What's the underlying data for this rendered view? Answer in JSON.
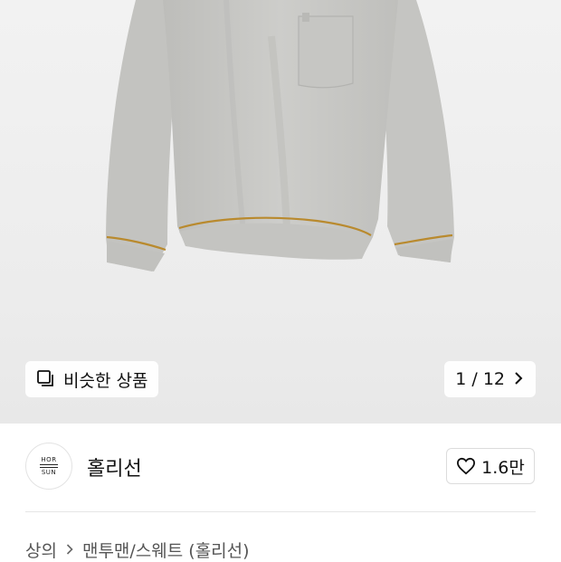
{
  "product_image": {
    "alt": "light gray sweatshirt with chest pocket"
  },
  "similar_products": {
    "label": "비슷한 상품",
    "icon": "similar-icon"
  },
  "image_counter": {
    "text": "1 / 12",
    "icon": "chevron-right-icon"
  },
  "brand": {
    "logo_top": "HOR",
    "logo_bottom": "SUN",
    "name": "홀리선"
  },
  "like": {
    "count": "1.6만",
    "icon": "heart-icon"
  },
  "breadcrumb": {
    "category": "상의",
    "separator_icon": "chevron-right-icon",
    "subcategory": "맨투맨/스웨트 (홀리선)"
  },
  "colors": {
    "garment": "#c9c9c6",
    "stitch": "#b98a2e"
  }
}
